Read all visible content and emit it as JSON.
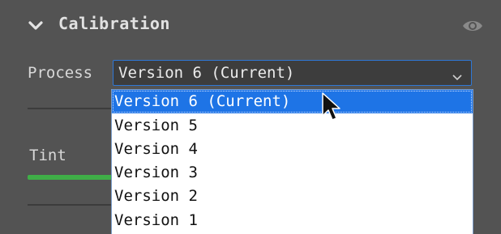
{
  "panel": {
    "title": "Calibration",
    "collapse_icon": "chevron-down-icon",
    "visibility_icon": "eye-icon"
  },
  "process": {
    "label": "Process",
    "selected": "Version 6 (Current)",
    "options": [
      "Version 6 (Current)",
      "Version 5",
      "Version 4",
      "Version 3",
      "Version 2",
      "Version 1"
    ],
    "highlighted_index": 0
  },
  "tint": {
    "label": "Tint"
  },
  "colors": {
    "panel_bg": "#535353",
    "accent_blue": "#1e74e6",
    "slider_green": "#3fae47"
  }
}
